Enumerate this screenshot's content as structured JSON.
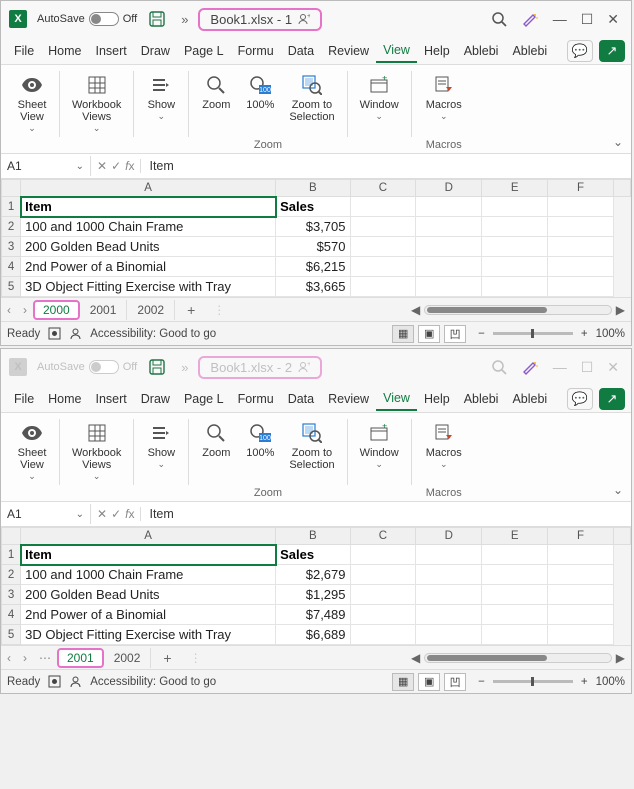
{
  "windows": [
    {
      "dim": false,
      "autosave_label": "AutoSave",
      "autosave_state": "Off",
      "title": "Book1.xlsx  -  1",
      "active_sheet_highlight": "2000",
      "namebox": "A1",
      "fx_value": "Item",
      "sheets": [
        "2000",
        "2001",
        "2002"
      ],
      "show_ellipsis": false,
      "rows": [
        {
          "n": 1,
          "a": "Item",
          "b": "Sales",
          "hdr": true
        },
        {
          "n": 2,
          "a": "100 and 1000 Chain Frame",
          "b": "$3,705"
        },
        {
          "n": 3,
          "a": "200 Golden Bead Units",
          "b": "$570"
        },
        {
          "n": 4,
          "a": "2nd Power of a Binomial",
          "b": "$6,215"
        },
        {
          "n": 5,
          "a": "3D Object Fitting Exercise with Tray",
          "b": "$3,665"
        }
      ]
    },
    {
      "dim": true,
      "autosave_label": "AutoSave",
      "autosave_state": "Off",
      "title": "Book1.xlsx  -  2",
      "active_sheet_highlight": "2001",
      "namebox": "A1",
      "fx_value": "Item",
      "sheets": [
        "2001",
        "2002"
      ],
      "show_ellipsis": true,
      "rows": [
        {
          "n": 1,
          "a": "Item",
          "b": "Sales",
          "hdr": true
        },
        {
          "n": 2,
          "a": "100 and 1000 Chain Frame",
          "b": "$2,679"
        },
        {
          "n": 3,
          "a": "200 Golden Bead Units",
          "b": "$1,295"
        },
        {
          "n": 4,
          "a": "2nd Power of a Binomial",
          "b": "$7,489"
        },
        {
          "n": 5,
          "a": "3D Object Fitting Exercise with Tray",
          "b": "$6,689"
        }
      ]
    }
  ],
  "menu": [
    "File",
    "Home",
    "Insert",
    "Draw",
    "Page L",
    "Formu",
    "Data",
    "Review",
    "View",
    "Help",
    "Ablebi",
    "Ablebi"
  ],
  "active_menu": "View",
  "ribbon": {
    "sheet_view": "Sheet\nView",
    "workbook_views": "Workbook\nViews",
    "show": "Show",
    "zoom": "Zoom",
    "pct100": "100%",
    "zoom_sel": "Zoom to\nSelection",
    "window": "Window",
    "macros": "Macros",
    "group_zoom": "Zoom",
    "group_macros": "Macros"
  },
  "columns": [
    "A",
    "B",
    "C",
    "D",
    "E",
    "F"
  ],
  "status": {
    "ready": "Ready",
    "acc": "Accessibility: Good to go",
    "zoom": "100%"
  }
}
